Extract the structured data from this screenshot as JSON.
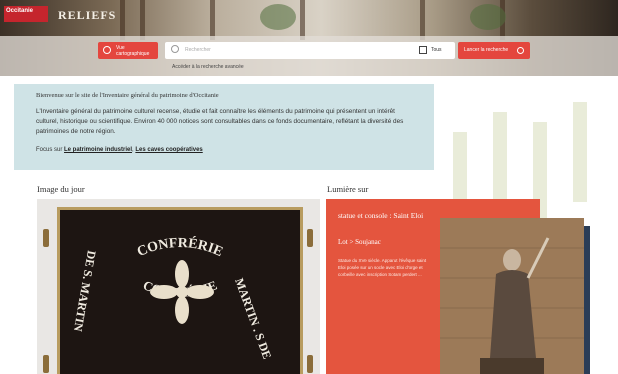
{
  "header": {
    "logo_text": "Occitanie",
    "logo_sub": "RELIEFS"
  },
  "search": {
    "carto_button": "Vue cartographique",
    "placeholder": "Rechercher",
    "filter_label": "Tous",
    "launch_button": "Lancer la recherche",
    "advanced_link": "Accéder à la recherche avancée"
  },
  "welcome": {
    "title": "Bienvenue sur le site de l'Inventaire général du patrimoine d'Occitanie",
    "body": "L'Inventaire général du patrimoine culturel recense, étudie et fait connaître les éléments du patrimoine qui présentent un intérêt culturel, historique ou scientifique. Environ 40 000 notices sont consultables dans ce fonds documentaire, reflétant la diversité des patrimoines de notre région.",
    "focus_prefix": "Focus sur",
    "focus_link_1": "Le patrimoine industriel",
    "focus_sep": ",",
    "focus_link_2": "Les caves coopératives"
  },
  "image_du_jour": {
    "title": "Image du jour",
    "banner_text_right": "MARTIN . S DE",
    "banner_text_left": "DE S. MARTIN",
    "banner_text_bottom": "CONFRÉRIE",
    "banner_text_top": "CONFRÉRIE"
  },
  "lumiere": {
    "title": "Lumière sur",
    "item_title": "statue et console : Saint Eloi",
    "location": "Lot > Soujanac",
    "description": "Statue du XVe siècle. Apparut l'évêque saint Eloi posée sur un socle avec Eloi d'orge et corbeille avec inscription Sotam perdert ..."
  },
  "colors": {
    "accent_red": "#e4463e",
    "welcome_bg": "#cfe3e6",
    "navy": "#2b3d57"
  }
}
